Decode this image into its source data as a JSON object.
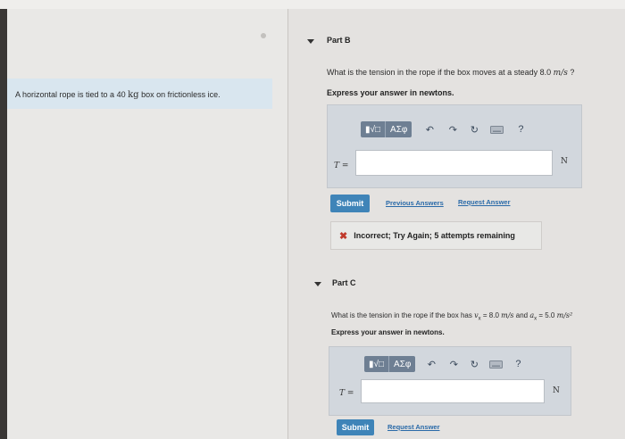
{
  "left": {
    "problem_prefix": "A horizontal rope is tied to a 40",
    "problem_unit": "kg",
    "problem_suffix": "box on frictionless ice."
  },
  "part_b": {
    "title": "Part B",
    "question_prefix": "What is the tension in the rope if the box moves at a steady 8.0",
    "question_unit": "m/s",
    "question_suffix": "?",
    "instruction": "Express your answer in newtons.",
    "toolbar": {
      "sqrt_label": "▮√□",
      "greek_label": "ΑΣφ",
      "help_label": "?"
    },
    "variable": "T =",
    "value": "",
    "unit": "N",
    "submit_label": "Submit",
    "previous_answers_label": "Previous Answers",
    "request_answer_label": "Request Answer",
    "feedback_icon": "✖",
    "feedback_text": "Incorrect; Try Again; 5 attempts remaining"
  },
  "part_c": {
    "title": "Part C",
    "question_prefix": "What is the tension in the rope if the box has",
    "question_vx": "v",
    "question_vsub": "x",
    "question_v_value": "= 8.0",
    "question_v_unit": "m/s",
    "question_and": "and",
    "question_ax": "a",
    "question_asub": "x",
    "question_a_value": "= 5.0",
    "question_a_unit": "m/s²",
    "instruction": "Express your answer in newtons.",
    "toolbar": {
      "sqrt_label": "▮√□",
      "greek_label": "ΑΣφ",
      "help_label": "?"
    },
    "variable": "T =",
    "value": "",
    "unit": "N",
    "submit_label": "Submit",
    "request_answer_label": "Request Answer"
  },
  "colors": {
    "accent": "#3f84b8",
    "link": "#2a6aa8",
    "error": "#c0392b",
    "problem_bg": "#d9e6ef"
  },
  "icons": [
    "caret-down-icon",
    "undo-icon",
    "redo-icon",
    "reset-icon",
    "keyboard-icon",
    "help-icon",
    "error-x-icon"
  ]
}
